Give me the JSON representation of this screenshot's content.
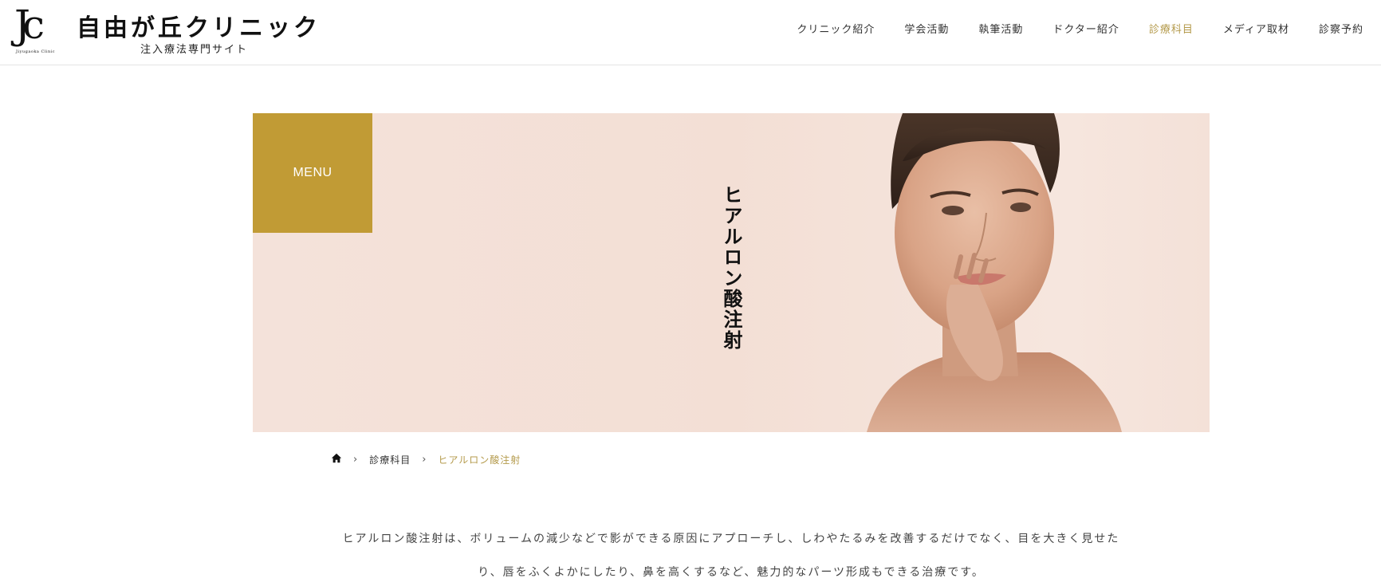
{
  "header": {
    "logo": {
      "mark": "Jc",
      "mark_caption": "Jiyugaoka Clinic",
      "title": "自由が丘クリニック",
      "tagline": "注入療法専門サイト"
    },
    "nav": [
      {
        "label": "クリニック紹介",
        "active": false
      },
      {
        "label": "学会活動",
        "active": false
      },
      {
        "label": "執筆活動",
        "active": false
      },
      {
        "label": "ドクター紹介",
        "active": false
      },
      {
        "label": "診療科目",
        "active": true
      },
      {
        "label": "メディア取材",
        "active": false
      },
      {
        "label": "診察予約",
        "active": false
      }
    ]
  },
  "hero": {
    "menu_label": "MENU",
    "title": "ヒアルロン酸注射",
    "background_color": "#f2dfd6",
    "menu_color": "#c19b35"
  },
  "breadcrumb": {
    "home_icon": "home-icon",
    "items": [
      "診療科目",
      "ヒアルロン酸注射"
    ]
  },
  "intro": {
    "line1": "ヒアルロン酸注射は、ボリュームの減少などで影ができる原因にアプローチし、しわやたるみを改善するだけでなく、目を大きく見せた",
    "line2": "り、唇をふくよかにしたり、鼻を高くするなど、魅力的なパーツ形成もできる治療です。"
  },
  "colors": {
    "accent": "#b49a4b",
    "text": "#333333"
  }
}
